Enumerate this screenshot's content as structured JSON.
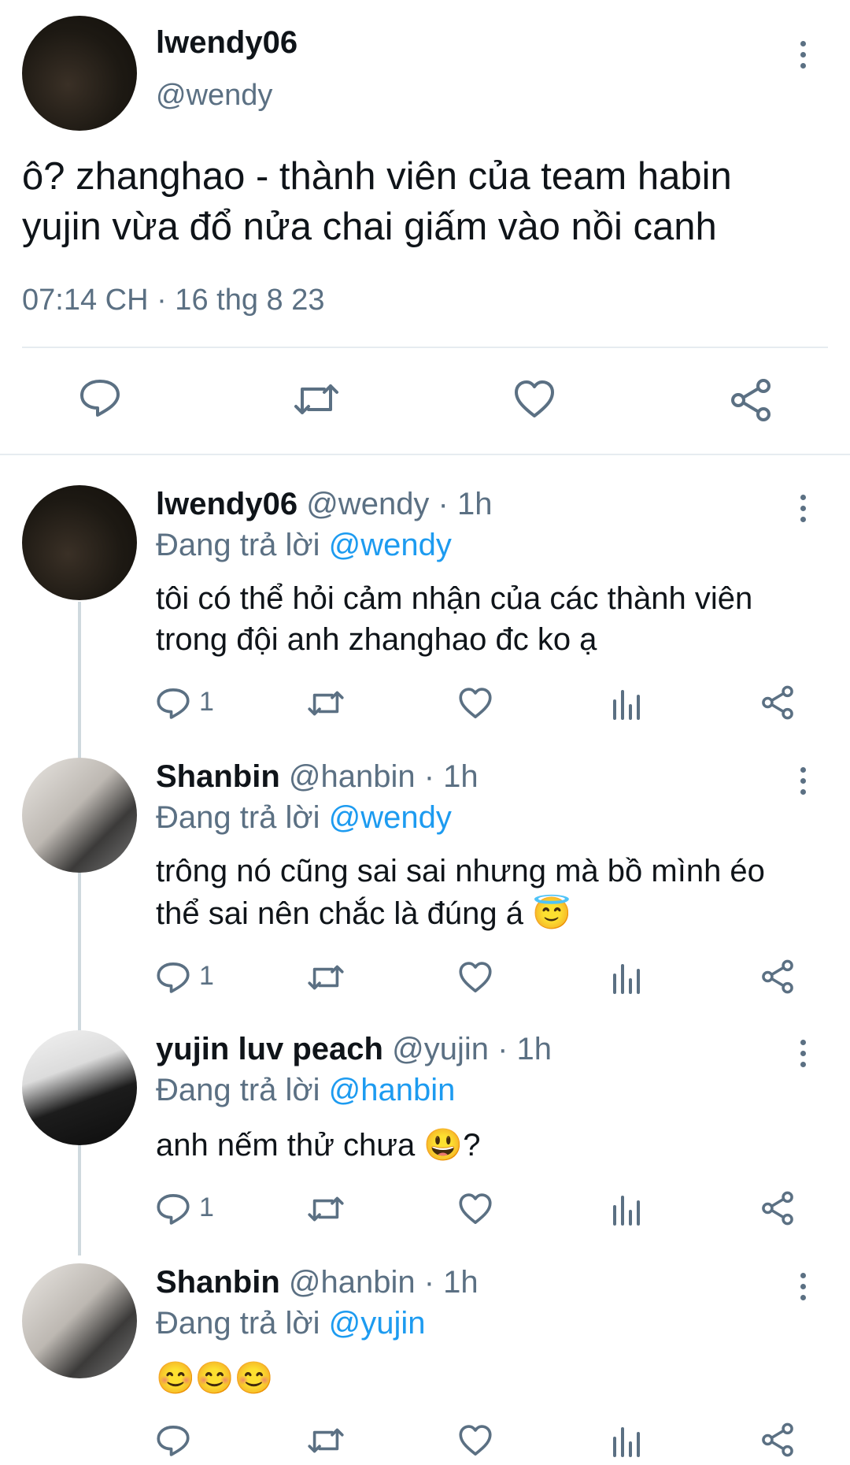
{
  "main_tweet": {
    "display_name": "lwendy06",
    "handle": "@wendy",
    "text_line1": "ô? zhanghao - thành viên của team habin",
    "text_line2": "yujin vừa đổ nửa chai giấm vào nồi canh",
    "timestamp": "07:14 CH · 16 thg 8 23"
  },
  "replies": [
    {
      "display_name": "lwendy06",
      "meta": "@wendy · 1h",
      "reply_prefix": "Đang trả lời",
      "reply_to": "@wendy",
      "text_line1": "tôi có thể hỏi cảm nhận của các thành viên",
      "text_line2": "trong đội anh zhanghao đc ko ạ",
      "reply_count": "1"
    },
    {
      "display_name": "Shanbin",
      "meta": "@hanbin · 1h",
      "reply_prefix": "Đang trả lời",
      "reply_to": "@wendy",
      "text_line1": "trông nó cũng sai sai nhưng mà bồ mình éo",
      "text_line2": "thể sai nên chắc là đúng á 😇",
      "reply_count": "1"
    },
    {
      "display_name": "yujin luv peach",
      "meta": "@yujin · 1h",
      "reply_prefix": "Đang trả lời",
      "reply_to": "@hanbin",
      "text_line1": "anh nếm thử chưa 😃?",
      "reply_count": "1"
    },
    {
      "display_name": "Shanbin",
      "meta": "@hanbin · 1h",
      "reply_prefix": "Đang trả lời",
      "reply_to": "@yujin",
      "text_line1": "😊😊😊"
    }
  ],
  "icons": {
    "reply": "reply-icon",
    "retweet": "retweet-icon",
    "like": "heart-icon",
    "analytics": "analytics-icon",
    "share": "share-icon",
    "more": "more-vertical-icon"
  },
  "colors": {
    "link": "#1d9bf0",
    "muted": "#5b7083",
    "divider": "#e6ecf0",
    "text": "#0f1419"
  }
}
